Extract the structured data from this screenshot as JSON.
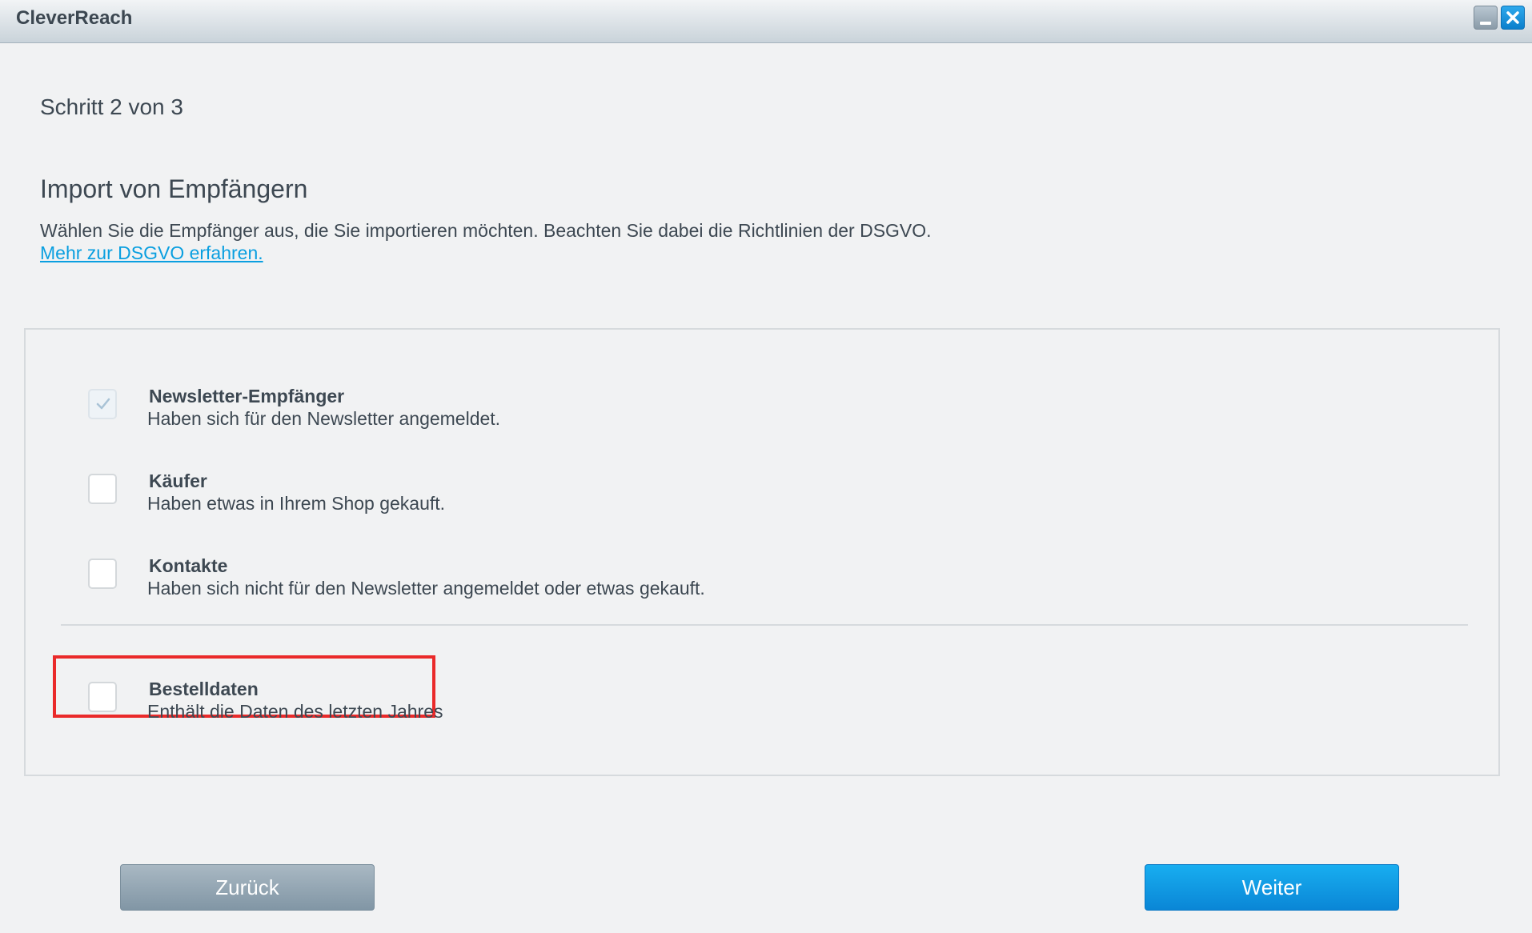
{
  "window": {
    "title": "CleverReach",
    "minimize_icon": "minimize-icon",
    "close_icon": "close-icon"
  },
  "wizard": {
    "step_text": "Schritt 2 von 3",
    "heading": "Import von Empfängern",
    "description": "Wählen Sie die Empfänger aus, die Sie importieren möchten. Beachten Sie dabei die Richtlinien der DSGVO.",
    "link_text": "Mehr zur DSGVO erfahren."
  },
  "options": [
    {
      "title": "Newsletter-Empfänger",
      "subtitle": "Haben sich für den Newsletter angemeldet.",
      "checked": true,
      "disabled": true
    },
    {
      "title": "Käufer",
      "subtitle": "Haben etwas in Ihrem Shop gekauft.",
      "checked": false
    },
    {
      "title": "Kontakte",
      "subtitle": "Haben sich nicht für den Newsletter angemeldet oder etwas gekauft.",
      "checked": false
    },
    {
      "title": "Bestelldaten",
      "subtitle": "Enthält die Daten des letzten Jahres",
      "checked": false,
      "highlighted": true
    }
  ],
  "buttons": {
    "back_label": "Zurück",
    "next_label": "Weiter"
  },
  "colors": {
    "accent": "#0a9fe0",
    "highlight_border": "#ea2a2a",
    "background": "#f1f2f3"
  }
}
